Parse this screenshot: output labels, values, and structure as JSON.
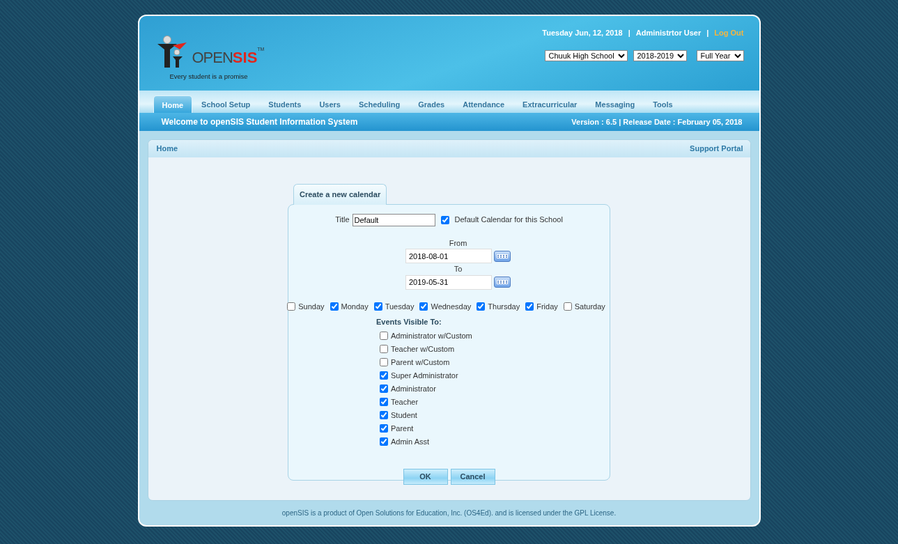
{
  "logo": {
    "word_1": "OPEN",
    "word_2": "SIS",
    "trademark": "TM",
    "tagline": "Every student is a promise"
  },
  "header": {
    "date": "Tuesday Jun, 12, 2018",
    "separator_1": "|",
    "user": "Administrtor User",
    "separator_2": "|",
    "logout": "Log Out",
    "selects": [
      {
        "value": "Chuuk High School"
      },
      {
        "value": "2018-2019"
      },
      {
        "value": "Full Year"
      }
    ]
  },
  "tabs": [
    {
      "label": "Home",
      "selected": true
    },
    {
      "label": "School Setup",
      "selected": false
    },
    {
      "label": "Students",
      "selected": false
    },
    {
      "label": "Users",
      "selected": false
    },
    {
      "label": "Scheduling",
      "selected": false
    },
    {
      "label": "Grades",
      "selected": false
    },
    {
      "label": "Attendance",
      "selected": false
    },
    {
      "label": "Extracurricular",
      "selected": false
    },
    {
      "label": "Messaging",
      "selected": false
    },
    {
      "label": "Tools",
      "selected": false
    }
  ],
  "welcome_bar": {
    "text": "Welcome to openSIS Student Information System",
    "version": "Version : 6.5 | Release Date : February 05, 2018"
  },
  "breadcrumb": {
    "home": "Home",
    "support": "Support Portal"
  },
  "form": {
    "tab": "Create a new calendar",
    "title_label": "Title",
    "title_value": "Default",
    "default_label": "Default Calendar for this School",
    "default_checked": true,
    "from_label": "From",
    "from_value": "2018-08-01",
    "to_label": "To",
    "to_value": "2019-05-31",
    "days": [
      {
        "label": "Sunday",
        "checked": false
      },
      {
        "label": "Monday",
        "checked": true
      },
      {
        "label": "Tuesday",
        "checked": true
      },
      {
        "label": "Wednesday",
        "checked": true
      },
      {
        "label": "Thursday",
        "checked": true
      },
      {
        "label": "Friday",
        "checked": true
      },
      {
        "label": "Saturday",
        "checked": false
      }
    ],
    "visible_heading": "Events Visible To:",
    "roles": [
      {
        "label": "Administrator w/Custom",
        "checked": false
      },
      {
        "label": "Teacher w/Custom",
        "checked": false
      },
      {
        "label": "Parent w/Custom",
        "checked": false
      },
      {
        "label": "Super Administrator",
        "checked": true
      },
      {
        "label": "Administrator",
        "checked": true
      },
      {
        "label": "Teacher",
        "checked": true
      },
      {
        "label": "Student",
        "checked": true
      },
      {
        "label": "Parent",
        "checked": true
      },
      {
        "label": "Admin Asst",
        "checked": true
      }
    ],
    "buttons": [
      "OK",
      "Cancel"
    ]
  },
  "footer": "openSIS is a product of Open Solutions for Education, Inc. (OS4Ed). and is licensed under the GPL License."
}
